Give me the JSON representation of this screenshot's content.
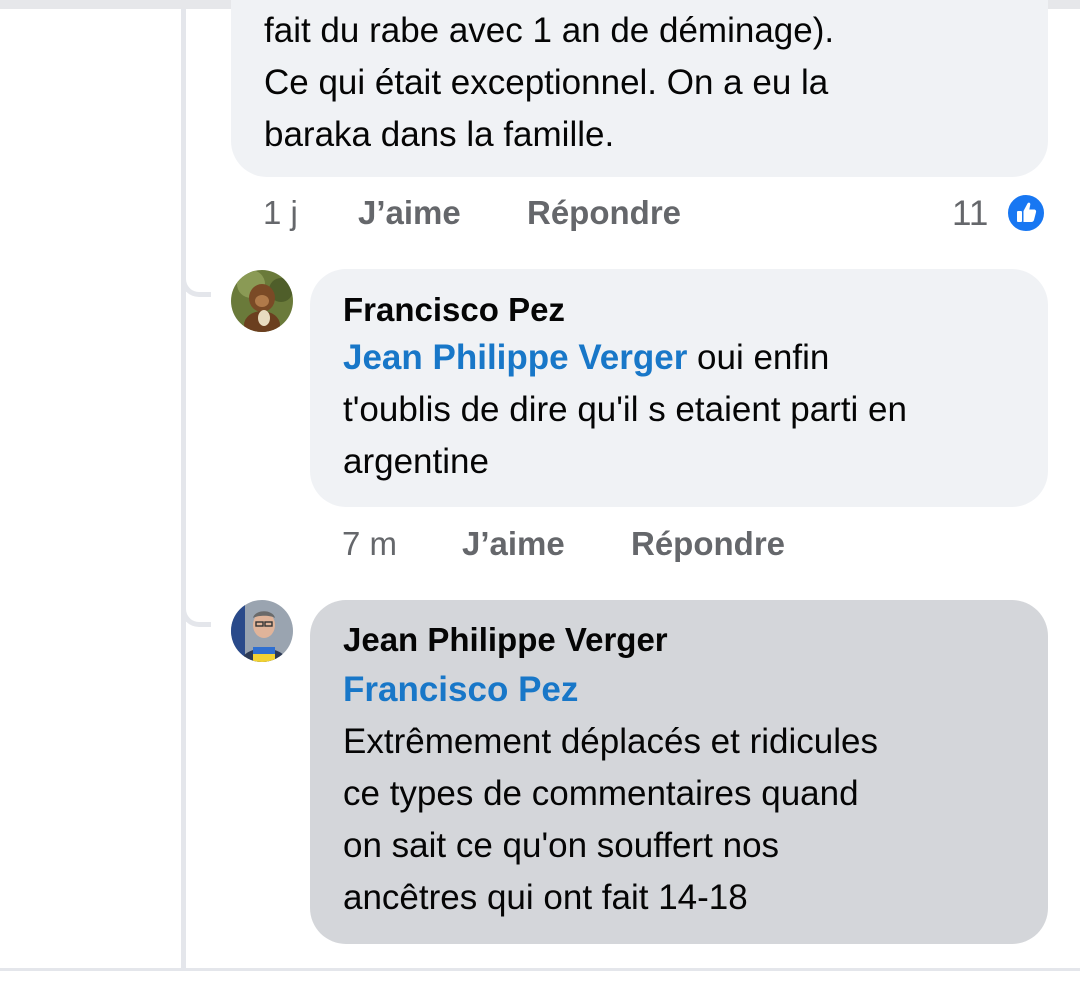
{
  "comment_prev": {
    "text_lines": "fait du rabe avec 1 an de déminage).\nCe qui était exceptionnel. On a eu la\nbaraka dans la famille.",
    "time": "1 j",
    "like_label": "J’aime",
    "reply_label": "Répondre",
    "reaction_count": "11",
    "reaction_icon": "like-thumb-icon"
  },
  "reply_1": {
    "author": "Francisco Pez",
    "mention": "Jean Philippe Verger",
    "text_after_mention": " oui enfin",
    "text_rest": "t'oublis de dire qu'il s etaient parti en\nargentine",
    "time": "7 m",
    "like_label": "J’aime",
    "reply_label": "Répondre"
  },
  "reply_2": {
    "author": "Jean Philippe Verger",
    "mention": "Francisco Pez",
    "text": "Extrêmement déplacés et ridicules\nce types de commentaires quand\non sait ce qu'on souffert nos\nancêtres qui ont fait 14-18"
  },
  "colors": {
    "mention_blue": "#1877c8",
    "bubble_light": "#f0f2f5",
    "bubble_selected": "#d4d6da",
    "meta_grey": "#65676b",
    "like_blue": "#1877f2"
  }
}
